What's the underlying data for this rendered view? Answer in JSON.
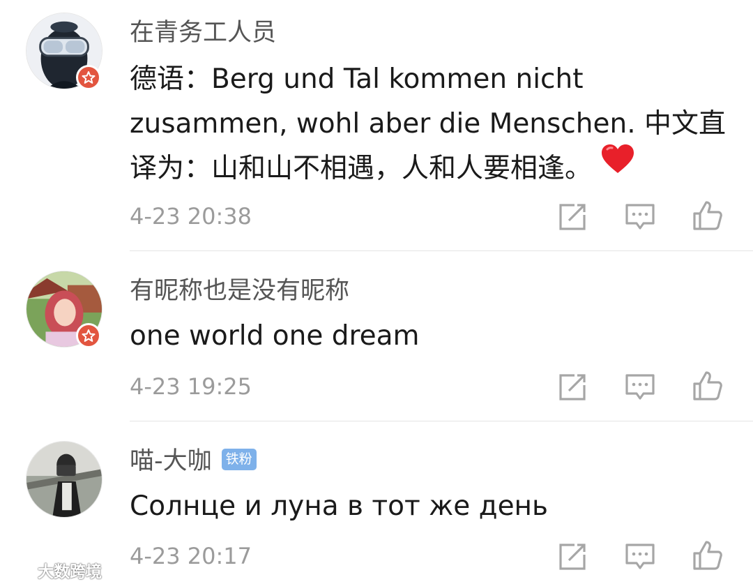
{
  "comments": [
    {
      "username": "在青务工人员",
      "text": "德语：Berg und Tal kommen nicht zusammen, wohl aber die Menschen. 中文直译为：山和山不相遇，人和人要相逢。",
      "emoji": "heart-emoji",
      "time": "4-23 20:38",
      "verified": true
    },
    {
      "username": "有昵称也是没有昵称",
      "text": "one world one dream",
      "time": "4-23 19:25",
      "verified": true
    },
    {
      "username": "喵-大咖",
      "badge": "铁粉",
      "text": "Солнце и луна в тот же день",
      "time": "4-23 20:17",
      "verified": false
    }
  ],
  "watermark": {
    "text": "大数跨境"
  },
  "colors": {
    "username": "#555555",
    "body_text": "#1a1a1a",
    "timestamp": "#9b9b9b",
    "icon": "#a6a6a6",
    "verified_badge": "#e2553f",
    "fan_badge": "#7eb1ea",
    "heart": "#e8202a",
    "divider": "#e4e4e4"
  },
  "icons": [
    "repost-icon",
    "comment-icon",
    "like-icon",
    "verified-badge-icon",
    "heart-emoji",
    "watermark-logo-icon"
  ]
}
